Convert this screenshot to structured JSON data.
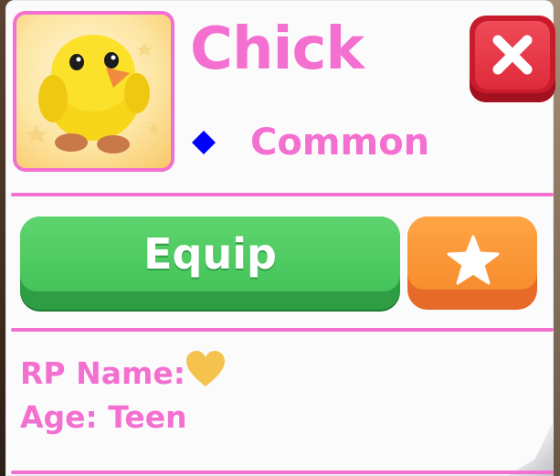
{
  "pet": {
    "name": "Chick",
    "rarity": "Common",
    "rarity_color": "#0000ff",
    "accent_color": "#f36fd0",
    "image_icon": "chick-pet-icon"
  },
  "actions": {
    "close_icon": "close-x-icon",
    "equip_label": "Equip",
    "favorite_icon": "star-icon"
  },
  "details": {
    "rp_name_label": "RP Name:",
    "rp_name_value_icon": "heart-icon",
    "age_line": "Age: Teen"
  }
}
